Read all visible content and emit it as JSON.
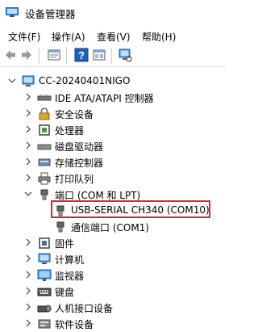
{
  "window": {
    "title": "设备管理器"
  },
  "menu": [
    "文件(F)",
    "操作(A)",
    "查看(V)",
    "帮助(H)"
  ],
  "toolbar": [
    {
      "name": "back-icon"
    },
    {
      "name": "forward-icon"
    },
    {
      "name": "properties-icon"
    },
    {
      "name": "help-icon"
    },
    {
      "name": "show-hidden-icon"
    },
    {
      "name": "scan-hardware-icon"
    }
  ],
  "tree": {
    "root": "CC-20240401NIGO",
    "items": [
      {
        "label": "IDE ATA/ATAPI 控制器",
        "icon": "ide-controller-icon",
        "expanded": false
      },
      {
        "label": "安全设备",
        "icon": "security-device-icon",
        "expanded": false
      },
      {
        "label": "处理器",
        "icon": "processor-icon",
        "expanded": false
      },
      {
        "label": "磁盘驱动器",
        "icon": "disk-drive-icon",
        "expanded": false
      },
      {
        "label": "存储控制器",
        "icon": "storage-controller-icon",
        "expanded": false
      },
      {
        "label": "打印队列",
        "icon": "printer-icon",
        "expanded": false
      },
      {
        "label": "端口 (COM 和 LPT)",
        "icon": "port-icon",
        "expanded": true,
        "children": [
          {
            "label": "USB-SERIAL CH340 (COM10)",
            "icon": "port-icon",
            "highlighted": true
          },
          {
            "label": "通信端口 (COM1)",
            "icon": "port-icon"
          }
        ]
      },
      {
        "label": "固件",
        "icon": "firmware-icon",
        "expanded": false
      },
      {
        "label": "计算机",
        "icon": "computer-icon",
        "expanded": false
      },
      {
        "label": "监视器",
        "icon": "monitor-icon",
        "expanded": false
      },
      {
        "label": "键盘",
        "icon": "keyboard-icon",
        "expanded": false
      },
      {
        "label": "人机接口设备",
        "icon": "hid-icon",
        "expanded": false
      },
      {
        "label": "软件设备",
        "icon": "software-device-icon",
        "expanded": false
      }
    ]
  },
  "colors": {
    "highlight_border": "#d9252b",
    "accent": "#1e6fd9"
  }
}
